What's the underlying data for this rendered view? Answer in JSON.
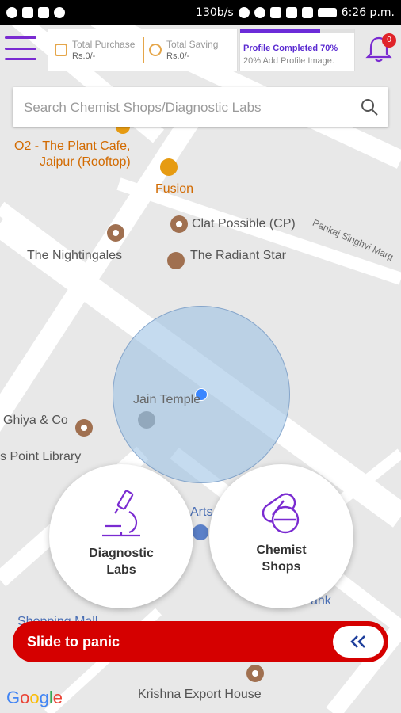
{
  "status_bar": {
    "network_speed": "130b/s",
    "battery": "",
    "time": "6:26 p.m."
  },
  "header": {
    "total_purchase_label": "Total Purchase",
    "total_purchase_value": "Rs.0/-",
    "total_saving_label": "Total Saving",
    "total_saving_value": "Rs.0/-",
    "profile_title": "Profile Completed 70%",
    "profile_sub": "20% Add Profile Image.",
    "profile_progress": 0.7,
    "notification_count": "0",
    "accent": "#7a2bd1"
  },
  "search": {
    "placeholder": "Search Chemist Shops/Diagnostic Labs"
  },
  "map": {
    "places": {
      "o2": "O2 - The Plant Cafe,",
      "o2_line2": "Jaipur (Rooftop)",
      "fusion": "Fusion",
      "clat": "Clat Possible (CP)",
      "nightingales": "The Nightingales",
      "radiant": "The Radiant Star",
      "pankaj": "Pankaj Singhvi Marg",
      "jain": "Jain Temple",
      "ghiya": "Ghiya & Co",
      "library": "s Point Library",
      "arts": "Arts",
      "shopping": "Shopping Mall",
      "bank": "ank",
      "krishna": "Krishna Export House"
    },
    "google": "Google"
  },
  "actions": {
    "diagnostic_line1": "Diagnostic",
    "diagnostic_line2": "Labs",
    "chemist_line1": "Chemist",
    "chemist_line2": "Shops"
  },
  "panic": {
    "label": "Slide to panic",
    "color": "#d50000"
  }
}
